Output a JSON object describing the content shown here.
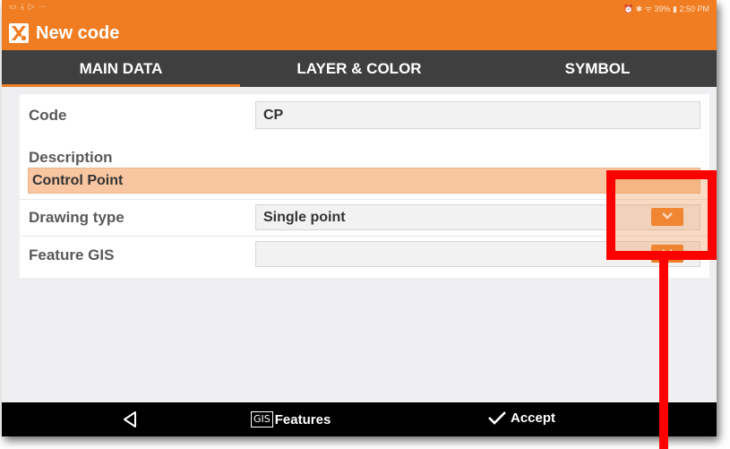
{
  "status_bar": {
    "left_icons": "▭ ⤓ ▷ ⋯",
    "right_text": "⏰ ✱ ᯤ 39% ▮ 2:50 PM"
  },
  "app": {
    "title": "New code"
  },
  "tabs": [
    {
      "label": "MAIN DATA",
      "active": true
    },
    {
      "label": "LAYER & COLOR",
      "active": false
    },
    {
      "label": "SYMBOL",
      "active": false
    }
  ],
  "form": {
    "code": {
      "label": "Code",
      "value": "CP"
    },
    "description": {
      "label": "Description",
      "value": "Control Point"
    },
    "drawing_type": {
      "label": "Drawing type",
      "value": "Single point"
    },
    "feature_gis": {
      "label": "Feature GIS",
      "value": ""
    }
  },
  "bottom_bar": {
    "gis_badge": "GIS",
    "features_label": "Features",
    "accept_label": "Accept"
  },
  "colors": {
    "accent": "#f07d22",
    "tabbar": "#3f3f3f",
    "highlight": "#ff0000",
    "description_bg": "#f8c7a1"
  },
  "icons": {
    "app_logo": "app-logo-icon",
    "dropdown": "chevron-down-icon",
    "back": "back-triangle-icon",
    "accept": "checkmark-icon"
  }
}
